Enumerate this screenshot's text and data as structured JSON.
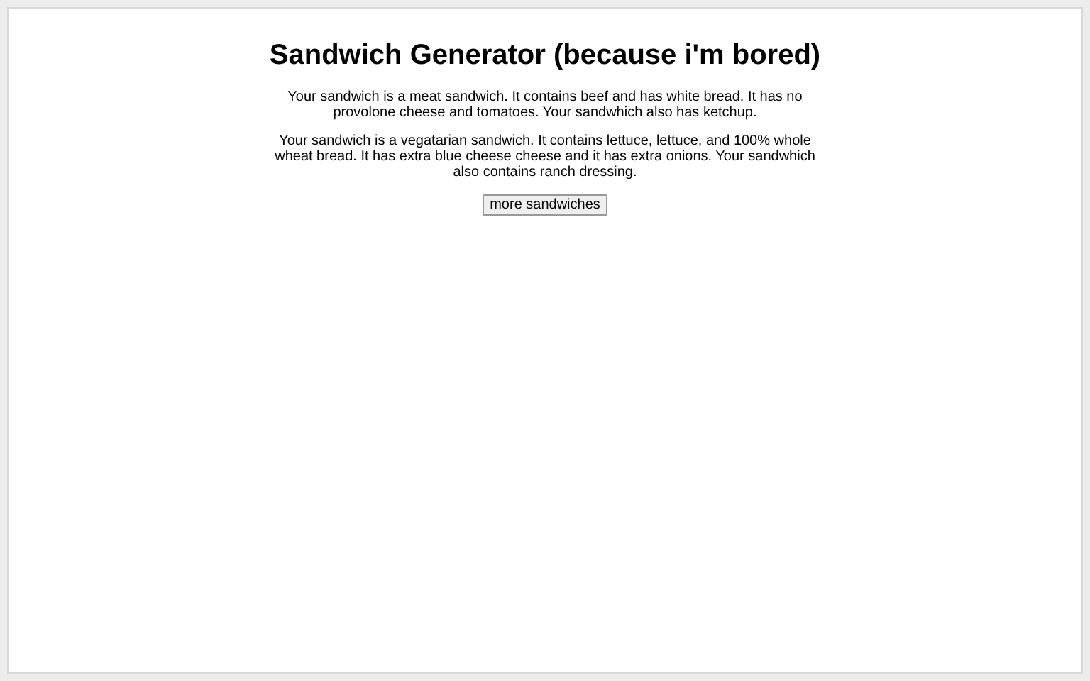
{
  "title": "Sandwich Generator (because i'm bored)",
  "paragraphs": [
    "Your sandwich is a meat sandwich. It contains beef and has white bread. It has no provolone cheese and tomatoes. Your sandwhich also has ketchup.",
    "Your sandwich is a vegatarian sandwich. It contains lettuce, lettuce, and 100% whole wheat bread. It has extra blue cheese cheese and it has extra onions. Your sandwhich also contains ranch dressing."
  ],
  "button": "more sandwiches"
}
